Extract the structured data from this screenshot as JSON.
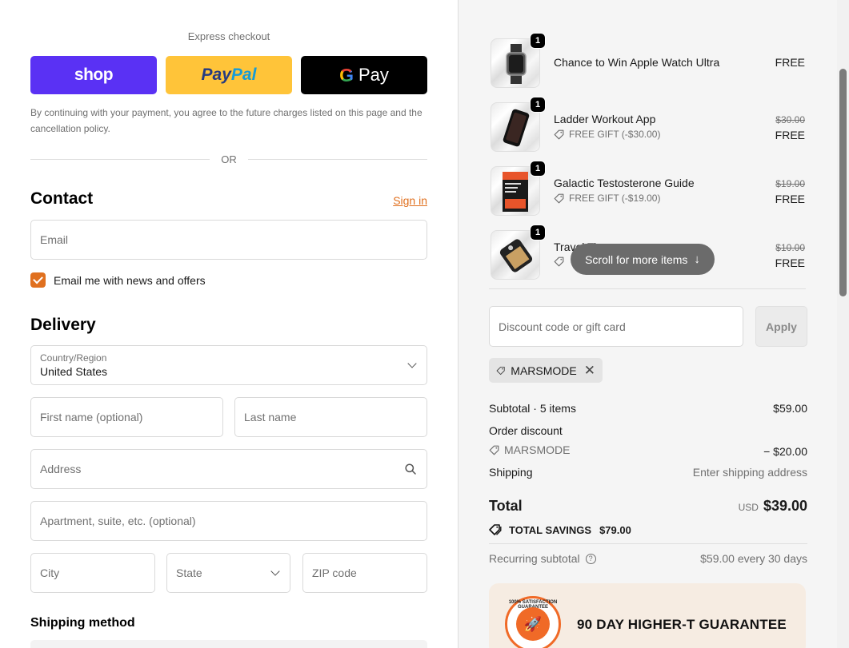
{
  "express": {
    "label": "Express checkout",
    "shop_label": "shop",
    "paypal_part1": "Pay",
    "paypal_part2": "Pal",
    "gpay_g": "G",
    "gpay_label": "Pay"
  },
  "consent_text": "By continuing with your payment, you agree to the future charges listed on this page and the cancellation policy.",
  "or_text": "OR",
  "contact": {
    "title": "Contact",
    "sign_in": "Sign in",
    "email_placeholder": "Email",
    "news_label": "Email me with news and offers",
    "news_checked": true
  },
  "delivery": {
    "title": "Delivery",
    "country_label": "Country/Region",
    "country_value": "United States",
    "first_name": "First name (optional)",
    "last_name": "Last name",
    "address": "Address",
    "apartment": "Apartment, suite, etc. (optional)",
    "city": "City",
    "state": "State",
    "zip": "ZIP code"
  },
  "shipping_method_title": "Shipping method",
  "items": [
    {
      "name": "Chance to Win Apple Watch Ultra",
      "qty": "1",
      "sub": "",
      "old_price": "",
      "price": "FREE",
      "thumb": "watch-thumbnail"
    },
    {
      "name": "Ladder Workout App",
      "qty": "1",
      "sub": "FREE GIFT (-$30.00)",
      "old_price": "$30.00",
      "price": "FREE",
      "thumb": "phone-app-thumbnail"
    },
    {
      "name": "Galactic Testosterone Guide",
      "qty": "1",
      "sub": "FREE GIFT (-$19.00)",
      "old_price": "$19.00",
      "price": "FREE",
      "thumb": "guide-book-thumbnail"
    },
    {
      "name": "Travel Ti",
      "qty": "1",
      "sub": "",
      "old_price": "$10.00",
      "price": "FREE",
      "thumb": "travel-tin-thumbnail"
    }
  ],
  "scroll_hint": "Scroll for more items",
  "discount": {
    "placeholder": "Discount code or gift card",
    "apply": "Apply",
    "applied_code": "MARSMODE"
  },
  "summary": {
    "subtotal_label": "Subtotal · 5 items",
    "subtotal_value": "$59.00",
    "order_discount_label": "Order discount",
    "discount_code": "MARSMODE",
    "discount_value": "− $20.00",
    "shipping_label": "Shipping",
    "shipping_value": "Enter shipping address",
    "total_label": "Total",
    "currency": "USD",
    "total_value": "$39.00",
    "savings_label": "TOTAL SAVINGS",
    "savings_value": "$79.00",
    "recurring_label": "Recurring subtotal",
    "recurring_value": "$59.00 every 30 days"
  },
  "guarantee": {
    "badge_text": "100% SATISFACTION GUARANTEE",
    "title": "90 DAY HIGHER-T GUARANTEE"
  },
  "colors": {
    "accent": "#e0701f",
    "shop_pay": "#5a31f4",
    "paypal": "#ffc439",
    "gpay": "#000000",
    "summary_bg": "#f5f5f5"
  }
}
